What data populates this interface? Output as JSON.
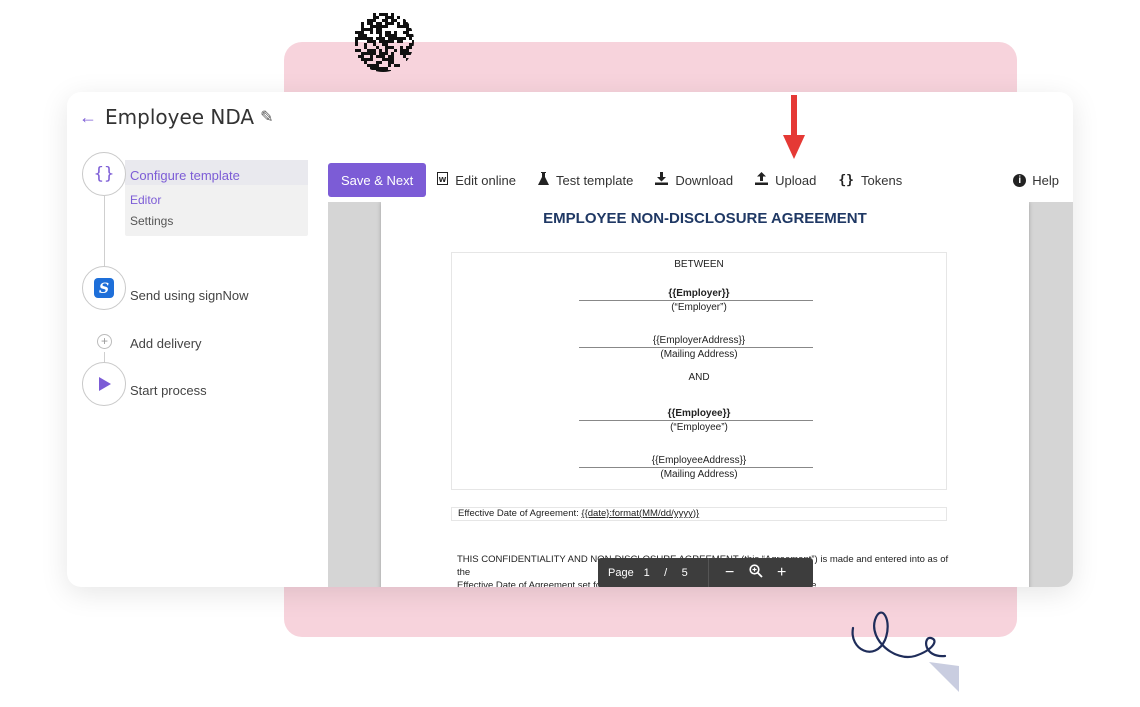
{
  "header": {
    "title": "Employee NDA",
    "back_icon": "arrow-left-icon",
    "edit_icon": "pencil-icon"
  },
  "sidebar": {
    "steps": [
      {
        "label": "Configure template",
        "icon": "braces-icon",
        "active": true,
        "sub_items": [
          {
            "label": "Editor",
            "active": true
          },
          {
            "label": "Settings",
            "active": false
          }
        ]
      },
      {
        "label": "Send using signNow",
        "icon": "signnow-logo-icon",
        "active": false
      },
      {
        "label": "Add delivery",
        "icon": "plus-circle-icon",
        "active": false
      },
      {
        "label": "Start process",
        "icon": "play-icon",
        "active": false
      }
    ]
  },
  "toolbar": {
    "save_label": "Save & Next",
    "edit_online_label": "Edit online",
    "test_template_label": "Test template",
    "download_label": "Download",
    "upload_label": "Upload",
    "tokens_label": "Tokens",
    "help_label": "Help"
  },
  "document": {
    "title": "EMPLOYEE NON-DISCLOSURE AGREEMENT",
    "between": "BETWEEN",
    "employer_token": "{{Employer}}",
    "employer_caption": "(“Employer”)",
    "employer_address_token": "{{EmployerAddress}}",
    "mailing_caption": "(Mailing Address)",
    "and": "AND",
    "employee_token": "{{Employee}}",
    "employee_caption": "(“Employee”)",
    "employee_address_token": "{{EmployeeAddress}}",
    "effective_label": "Effective Date of Agreement: ",
    "effective_token": "{{date}:format(MM/dd/yyyy)}",
    "para_line1": "THIS CONFIDENTIALITY AND NON-DISCLOSURE AGREEMENT (this “Agreement”) is made and entered into as of the",
    "para_line2": "Effective Date of Agreement set forth above by and between Employer and Employee."
  },
  "pager": {
    "label": "Page",
    "current": "1",
    "separator": "/",
    "total": "5"
  },
  "colors": {
    "accent": "#7c5cd6",
    "pink_bg": "#f7d3dc",
    "doc_title": "#1f3864",
    "arrow": "#e53935"
  }
}
